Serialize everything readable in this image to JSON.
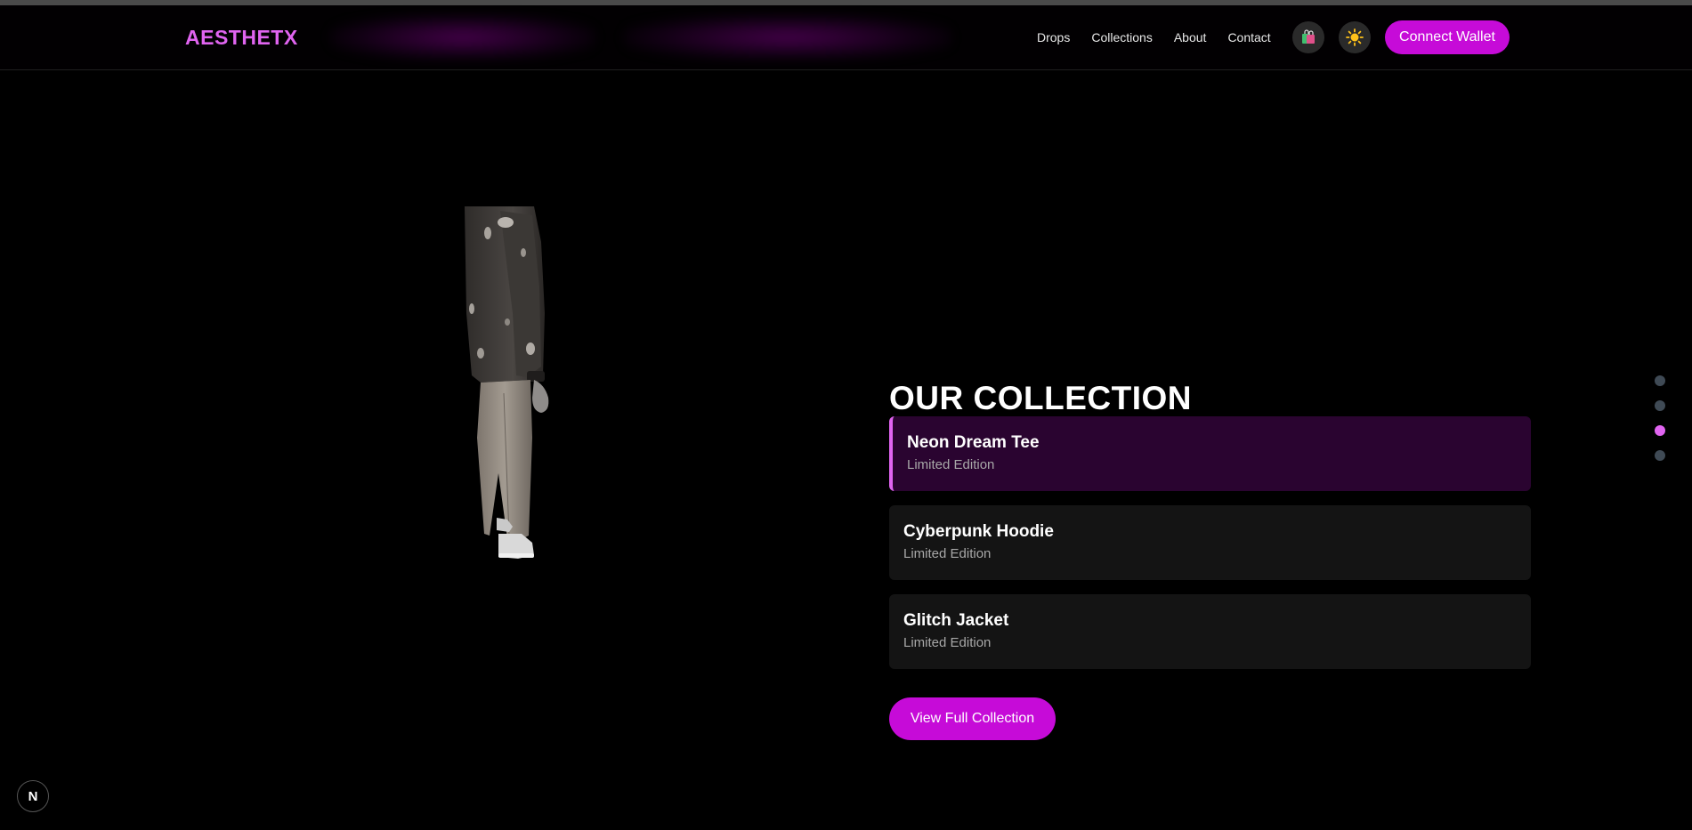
{
  "header": {
    "logo": "AESTHETX",
    "nav_links": [
      "Drops",
      "Collections",
      "About",
      "Contact"
    ],
    "cart_icon": "shopping-bag-icon",
    "theme_icon": "sun-icon",
    "connect_label": "Connect Wallet"
  },
  "colors": {
    "accent": "#c60bd8",
    "accent_light": "#e064f0",
    "background": "#000000",
    "card": "#141414",
    "card_active": "#2a0430"
  },
  "main": {
    "heading": "OUR COLLECTION",
    "items": [
      {
        "title": "Neon Dream Tee",
        "subtitle": "Limited Edition",
        "active": true
      },
      {
        "title": "Cyberpunk Hoodie",
        "subtitle": "Limited Edition",
        "active": false
      },
      {
        "title": "Glitch Jacket",
        "subtitle": "Limited Edition",
        "active": false
      }
    ],
    "cta_label": "View Full Collection"
  },
  "pagination": {
    "count": 4,
    "active_index": 2
  },
  "dev_badge": {
    "letter": "N"
  }
}
